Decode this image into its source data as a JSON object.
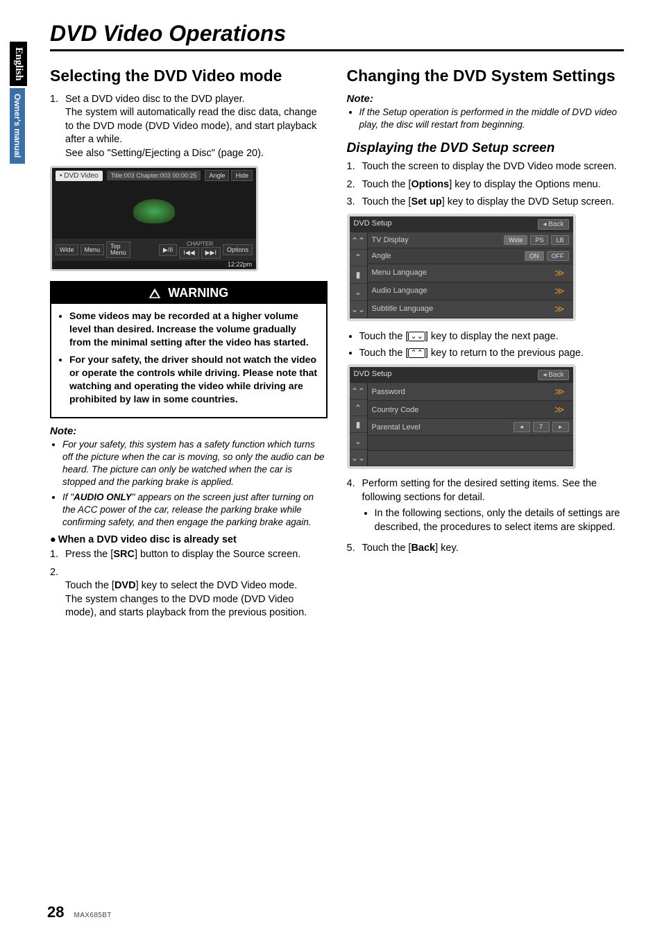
{
  "sideTabs": {
    "english": "English",
    "manual": "Owner's manual"
  },
  "pageTitle": "DVD Video Operations",
  "left": {
    "h2": "Selecting the DVD Video mode",
    "step1_text": "Set a DVD video disc to the DVD player.\nThe system will automatically read the disc data, change to the DVD mode (DVD Video mode), and start playback after a while.\nSee also \"Setting/Ejecting a Disc\" (page 20).",
    "screen": {
      "chip": "• DVD Video",
      "info_left": "Title:003  Chapter:003",
      "info_right": "00:00:25",
      "angle": "Angle",
      "hide": "Hide",
      "wide": "Wide",
      "menu": "Menu",
      "topmenu": "Top\nMenu",
      "play": "▶/II",
      "prev": "I◀◀",
      "next": "▶▶I",
      "chapterLbl": "CHAPTER",
      "options": "Options",
      "clock": "12:22pm"
    },
    "warningTitle": "WARNING",
    "warn1": "Some videos may be recorded at a higher volume level than desired. Increase the volume gradually from the minimal setting after the video has started.",
    "warn2": "For your safety, the driver should not watch the video or operate the controls while driving. Please note that watching and operating the video while driving are prohibited by law in some countries.",
    "noteLabel": "Note:",
    "note1": "For your safety, this system has a safety function which turns off the picture when the car is moving, so only the audio can be heard. The picture can only be watched when the car is stopped and the parking brake is applied.",
    "note2_pre": "If \"",
    "note2_bold": "AUDIO ONLY",
    "note2_post": "\" appears on the screen just after turning on the ACC power of the car, release the parking brake while confirming safety, and then engage the parking brake again.",
    "alreadyHead": "When a DVD video disc is already set",
    "already1_pre": "Press the [",
    "already1_bold": "SRC",
    "already1_post": "] button to display the Source screen.",
    "already2_pre": "Touch the [",
    "already2_bold": "DVD",
    "already2_post": "] key to select the DVD Video mode.\nThe system changes to the DVD mode (DVD Video mode), and starts playback from the previous position."
  },
  "right": {
    "h2": "Changing the DVD System Settings",
    "noteLabel": "Note:",
    "note1": "If the Setup operation is performed in the middle of DVD video play, the disc will restart from beginning.",
    "sub1": "Displaying the DVD Setup screen",
    "step1": "Touch the screen to display the DVD Video mode screen.",
    "step2_pre": "Touch the [",
    "step2_bold": "Options",
    "step2_post": "] key to display the Options menu.",
    "step3_pre": "Touch the [",
    "step3_bold": "Set up",
    "step3_post": "] key to display the DVD Setup screen.",
    "panel1": {
      "title": "DVD Setup",
      "back": "◂ Back",
      "rows": [
        {
          "label": "TV Display",
          "opts": [
            "Wide",
            "PS",
            "LB"
          ],
          "active": 0
        },
        {
          "label": "Angle",
          "opts": [
            "ON",
            "OFF"
          ],
          "active": 0
        },
        {
          "label": "Menu Language",
          "go": true
        },
        {
          "label": "Audio Language",
          "go": true
        },
        {
          "label": "Subtitle Language",
          "go": true
        }
      ]
    },
    "bul1": "Touch the [⌄] key to display the next page.",
    "bul2": "Touch the [⌃] key to return to the previous page.",
    "panel2": {
      "title": "DVD Setup",
      "back": "◂ Back",
      "rows": [
        {
          "label": "Password",
          "go": true
        },
        {
          "label": "Country Code",
          "go": true
        },
        {
          "label": "Parental Level",
          "opts": [
            "◂",
            "7",
            "▸"
          ]
        }
      ]
    },
    "step4": "Perform setting for the desired setting items. See the following sections for detail.",
    "step4sub": "In the following sections, only the details of settings are described, the procedures to select items are skipped.",
    "step5_pre": "Touch the [",
    "step5_bold": "Back",
    "step5_post": "] key."
  },
  "footer": {
    "page": "28",
    "model": "MAX685BT"
  }
}
